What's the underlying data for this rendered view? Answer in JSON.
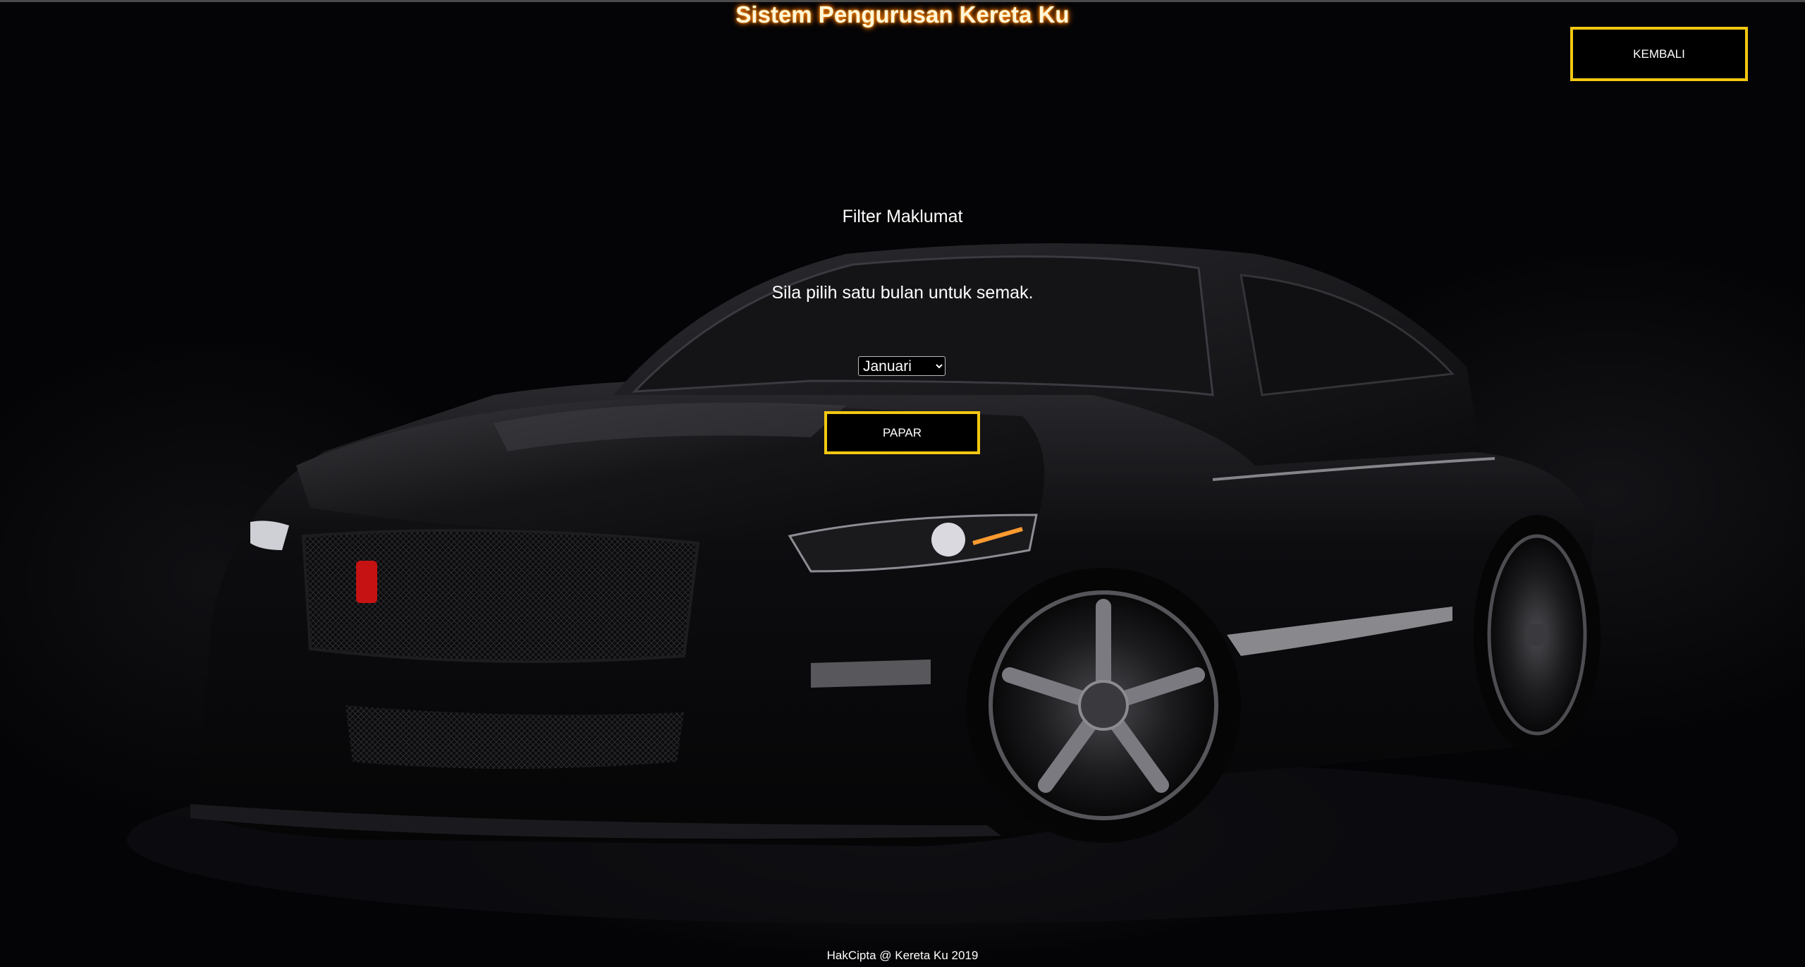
{
  "header": {
    "title": "Sistem Pengurusan Kereta Ku",
    "back_label": "KEMBALI"
  },
  "filter": {
    "title": "Filter Maklumat",
    "instruction": "Sila pilih satu bulan untuk semak.",
    "selected_month": "Januari",
    "submit_label": "PAPAR"
  },
  "footer": {
    "text": "HakCipta @ Kereta Ku 2019"
  },
  "background": {
    "image": "black-sports-car-icon"
  },
  "colors": {
    "accent": "#f2c811",
    "title_glow": "#ff8c00",
    "background": "#040406",
    "text": "#ffffff"
  }
}
